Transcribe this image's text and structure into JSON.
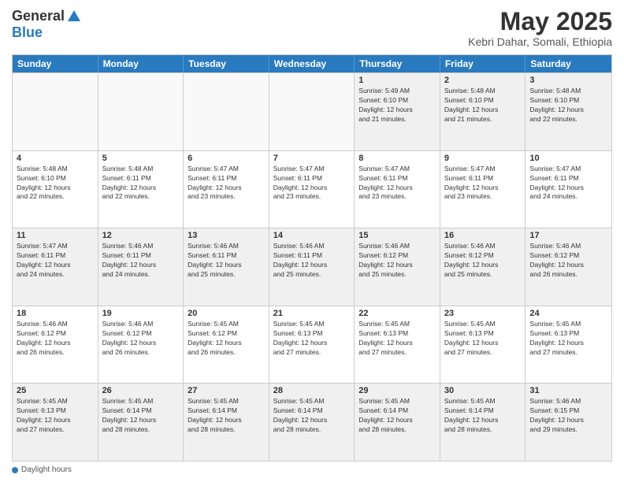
{
  "logo": {
    "general": "General",
    "blue": "Blue"
  },
  "title": "May 2025",
  "subtitle": "Kebri Dahar, Somali, Ethiopia",
  "days_of_week": [
    "Sunday",
    "Monday",
    "Tuesday",
    "Wednesday",
    "Thursday",
    "Friday",
    "Saturday"
  ],
  "footer_label": "Daylight hours",
  "weeks": [
    [
      {
        "day": "",
        "info": ""
      },
      {
        "day": "",
        "info": ""
      },
      {
        "day": "",
        "info": ""
      },
      {
        "day": "",
        "info": ""
      },
      {
        "day": "1",
        "info": "Sunrise: 5:49 AM\nSunset: 6:10 PM\nDaylight: 12 hours\nand 21 minutes."
      },
      {
        "day": "2",
        "info": "Sunrise: 5:48 AM\nSunset: 6:10 PM\nDaylight: 12 hours\nand 21 minutes."
      },
      {
        "day": "3",
        "info": "Sunrise: 5:48 AM\nSunset: 6:10 PM\nDaylight: 12 hours\nand 22 minutes."
      }
    ],
    [
      {
        "day": "4",
        "info": "Sunrise: 5:48 AM\nSunset: 6:10 PM\nDaylight: 12 hours\nand 22 minutes."
      },
      {
        "day": "5",
        "info": "Sunrise: 5:48 AM\nSunset: 6:11 PM\nDaylight: 12 hours\nand 22 minutes."
      },
      {
        "day": "6",
        "info": "Sunrise: 5:47 AM\nSunset: 6:11 PM\nDaylight: 12 hours\nand 23 minutes."
      },
      {
        "day": "7",
        "info": "Sunrise: 5:47 AM\nSunset: 6:11 PM\nDaylight: 12 hours\nand 23 minutes."
      },
      {
        "day": "8",
        "info": "Sunrise: 5:47 AM\nSunset: 6:11 PM\nDaylight: 12 hours\nand 23 minutes."
      },
      {
        "day": "9",
        "info": "Sunrise: 5:47 AM\nSunset: 6:11 PM\nDaylight: 12 hours\nand 23 minutes."
      },
      {
        "day": "10",
        "info": "Sunrise: 5:47 AM\nSunset: 6:11 PM\nDaylight: 12 hours\nand 24 minutes."
      }
    ],
    [
      {
        "day": "11",
        "info": "Sunrise: 5:47 AM\nSunset: 6:11 PM\nDaylight: 12 hours\nand 24 minutes."
      },
      {
        "day": "12",
        "info": "Sunrise: 5:46 AM\nSunset: 6:11 PM\nDaylight: 12 hours\nand 24 minutes."
      },
      {
        "day": "13",
        "info": "Sunrise: 5:46 AM\nSunset: 6:11 PM\nDaylight: 12 hours\nand 25 minutes."
      },
      {
        "day": "14",
        "info": "Sunrise: 5:46 AM\nSunset: 6:11 PM\nDaylight: 12 hours\nand 25 minutes."
      },
      {
        "day": "15",
        "info": "Sunrise: 5:46 AM\nSunset: 6:12 PM\nDaylight: 12 hours\nand 25 minutes."
      },
      {
        "day": "16",
        "info": "Sunrise: 5:46 AM\nSunset: 6:12 PM\nDaylight: 12 hours\nand 25 minutes."
      },
      {
        "day": "17",
        "info": "Sunrise: 5:46 AM\nSunset: 6:12 PM\nDaylight: 12 hours\nand 26 minutes."
      }
    ],
    [
      {
        "day": "18",
        "info": "Sunrise: 5:46 AM\nSunset: 6:12 PM\nDaylight: 12 hours\nand 26 minutes."
      },
      {
        "day": "19",
        "info": "Sunrise: 5:46 AM\nSunset: 6:12 PM\nDaylight: 12 hours\nand 26 minutes."
      },
      {
        "day": "20",
        "info": "Sunrise: 5:45 AM\nSunset: 6:12 PM\nDaylight: 12 hours\nand 26 minutes."
      },
      {
        "day": "21",
        "info": "Sunrise: 5:45 AM\nSunset: 6:13 PM\nDaylight: 12 hours\nand 27 minutes."
      },
      {
        "day": "22",
        "info": "Sunrise: 5:45 AM\nSunset: 6:13 PM\nDaylight: 12 hours\nand 27 minutes."
      },
      {
        "day": "23",
        "info": "Sunrise: 5:45 AM\nSunset: 6:13 PM\nDaylight: 12 hours\nand 27 minutes."
      },
      {
        "day": "24",
        "info": "Sunrise: 5:45 AM\nSunset: 6:13 PM\nDaylight: 12 hours\nand 27 minutes."
      }
    ],
    [
      {
        "day": "25",
        "info": "Sunrise: 5:45 AM\nSunset: 6:13 PM\nDaylight: 12 hours\nand 27 minutes."
      },
      {
        "day": "26",
        "info": "Sunrise: 5:45 AM\nSunset: 6:14 PM\nDaylight: 12 hours\nand 28 minutes."
      },
      {
        "day": "27",
        "info": "Sunrise: 5:45 AM\nSunset: 6:14 PM\nDaylight: 12 hours\nand 28 minutes."
      },
      {
        "day": "28",
        "info": "Sunrise: 5:45 AM\nSunset: 6:14 PM\nDaylight: 12 hours\nand 28 minutes."
      },
      {
        "day": "29",
        "info": "Sunrise: 5:45 AM\nSunset: 6:14 PM\nDaylight: 12 hours\nand 28 minutes."
      },
      {
        "day": "30",
        "info": "Sunrise: 5:45 AM\nSunset: 6:14 PM\nDaylight: 12 hours\nand 28 minutes."
      },
      {
        "day": "31",
        "info": "Sunrise: 5:46 AM\nSunset: 6:15 PM\nDaylight: 12 hours\nand 29 minutes."
      }
    ]
  ]
}
